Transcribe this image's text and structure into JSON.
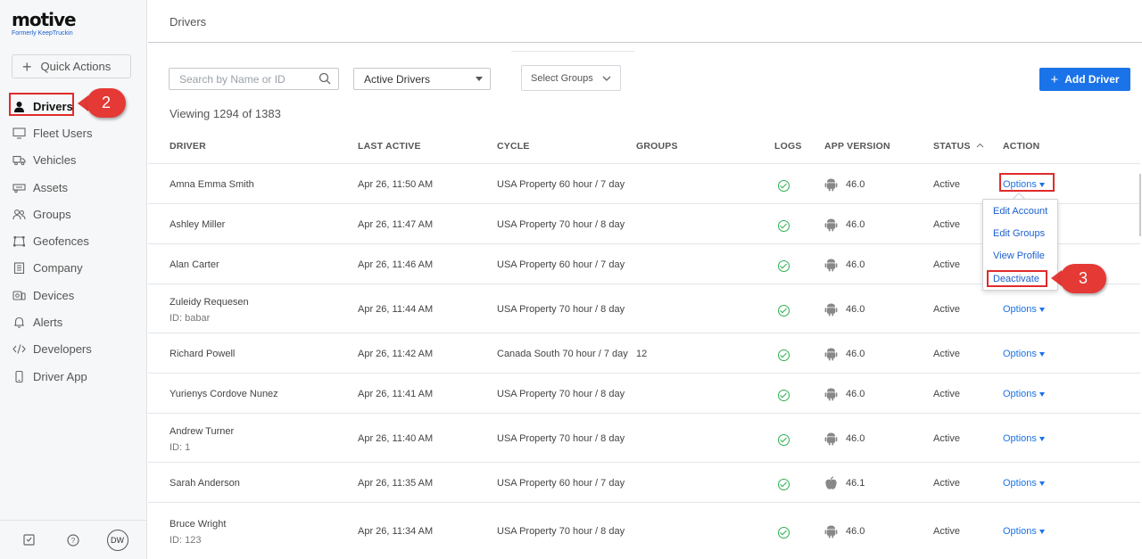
{
  "brand": {
    "name": "motive",
    "tagline": "Formerly KeepTruckin"
  },
  "sidebar": {
    "quick_actions": "Quick Actions",
    "items": [
      {
        "label": "Drivers",
        "icon": "person-icon",
        "active": true
      },
      {
        "label": "Fleet Users",
        "icon": "monitor-icon"
      },
      {
        "label": "Vehicles",
        "icon": "truck-icon"
      },
      {
        "label": "Assets",
        "icon": "trailer-icon"
      },
      {
        "label": "Groups",
        "icon": "users-icon"
      },
      {
        "label": "Geofences",
        "icon": "geofence-icon"
      },
      {
        "label": "Company",
        "icon": "building-icon"
      },
      {
        "label": "Devices",
        "icon": "devices-icon"
      },
      {
        "label": "Alerts",
        "icon": "bell-icon"
      },
      {
        "label": "Developers",
        "icon": "code-icon"
      },
      {
        "label": "Driver App",
        "icon": "phone-icon"
      }
    ],
    "footer": {
      "avatar": "DW",
      "help": "?"
    }
  },
  "header": {
    "title": "Drivers"
  },
  "toolbar": {
    "search_placeholder": "Search by Name or ID",
    "status_filter": "Active Drivers",
    "groups_filter": "Select Groups",
    "add_driver": "Add Driver"
  },
  "viewing": "Viewing 1294 of 1383",
  "table": {
    "columns": [
      "DRIVER",
      "LAST ACTIVE",
      "CYCLE",
      "GROUPS",
      "LOGS",
      "APP VERSION",
      "STATUS",
      "ACTION"
    ],
    "rows": [
      {
        "name": "Amna Emma Smith",
        "id": "",
        "last_active": "Apr 26, 11:50 AM",
        "cycle": "USA Property 60 hour / 7 day",
        "groups": "",
        "os": "android",
        "app_version": "46.0",
        "status": "Active",
        "action": "Options"
      },
      {
        "name": "Ashley Miller",
        "id": "",
        "last_active": "Apr 26, 11:47 AM",
        "cycle": "USA Property 70 hour / 8 day",
        "groups": "",
        "os": "android",
        "app_version": "46.0",
        "status": "Active",
        "action": "Options"
      },
      {
        "name": "Alan Carter",
        "id": "",
        "last_active": "Apr 26, 11:46 AM",
        "cycle": "USA Property 60 hour / 7 day",
        "groups": "",
        "os": "android",
        "app_version": "46.0",
        "status": "Active",
        "action": "Options"
      },
      {
        "name": "Zuleidy Requesen",
        "id": "ID: babar",
        "last_active": "Apr 26, 11:44 AM",
        "cycle": "USA Property 70 hour / 8 day",
        "groups": "",
        "os": "android",
        "app_version": "46.0",
        "status": "Active",
        "action": "Options"
      },
      {
        "name": "Richard Powell",
        "id": "",
        "last_active": "Apr 26, 11:42 AM",
        "cycle": "Canada South 70 hour / 7 day",
        "groups": "12",
        "os": "android",
        "app_version": "46.0",
        "status": "Active",
        "action": "Options"
      },
      {
        "name": "Yurienys Cordove Nunez",
        "id": "",
        "last_active": "Apr 26, 11:41 AM",
        "cycle": "USA Property 70 hour / 8 day",
        "groups": "",
        "os": "android",
        "app_version": "46.0",
        "status": "Active",
        "action": "Options"
      },
      {
        "name": "Andrew Turner",
        "id": "ID: 1",
        "last_active": "Apr 26, 11:40 AM",
        "cycle": "USA Property 70 hour / 8 day",
        "groups": "",
        "os": "android",
        "app_version": "46.0",
        "status": "Active",
        "action": "Options"
      },
      {
        "name": "Sarah Anderson",
        "id": "",
        "last_active": "Apr 26, 11:35 AM",
        "cycle": "USA Property 60 hour / 7 day",
        "groups": "",
        "os": "apple",
        "app_version": "46.1",
        "status": "Active",
        "action": "Options"
      },
      {
        "name": "Bruce Wright",
        "id": "ID: 123",
        "last_active": "Apr 26, 11:34 AM",
        "cycle": "USA Property 70 hour / 8 day",
        "groups": "",
        "os": "android",
        "app_version": "46.0",
        "status": "Active",
        "action": "Options"
      }
    ]
  },
  "options_menu": {
    "items": [
      "Edit Account",
      "Edit Groups",
      "View Profile",
      "Deactivate"
    ],
    "highlighted": "Deactivate"
  },
  "callouts": [
    "2",
    "3"
  ],
  "colors": {
    "accent": "#1a73e8",
    "annotation": "#e53935",
    "check": "#2eaf51"
  }
}
